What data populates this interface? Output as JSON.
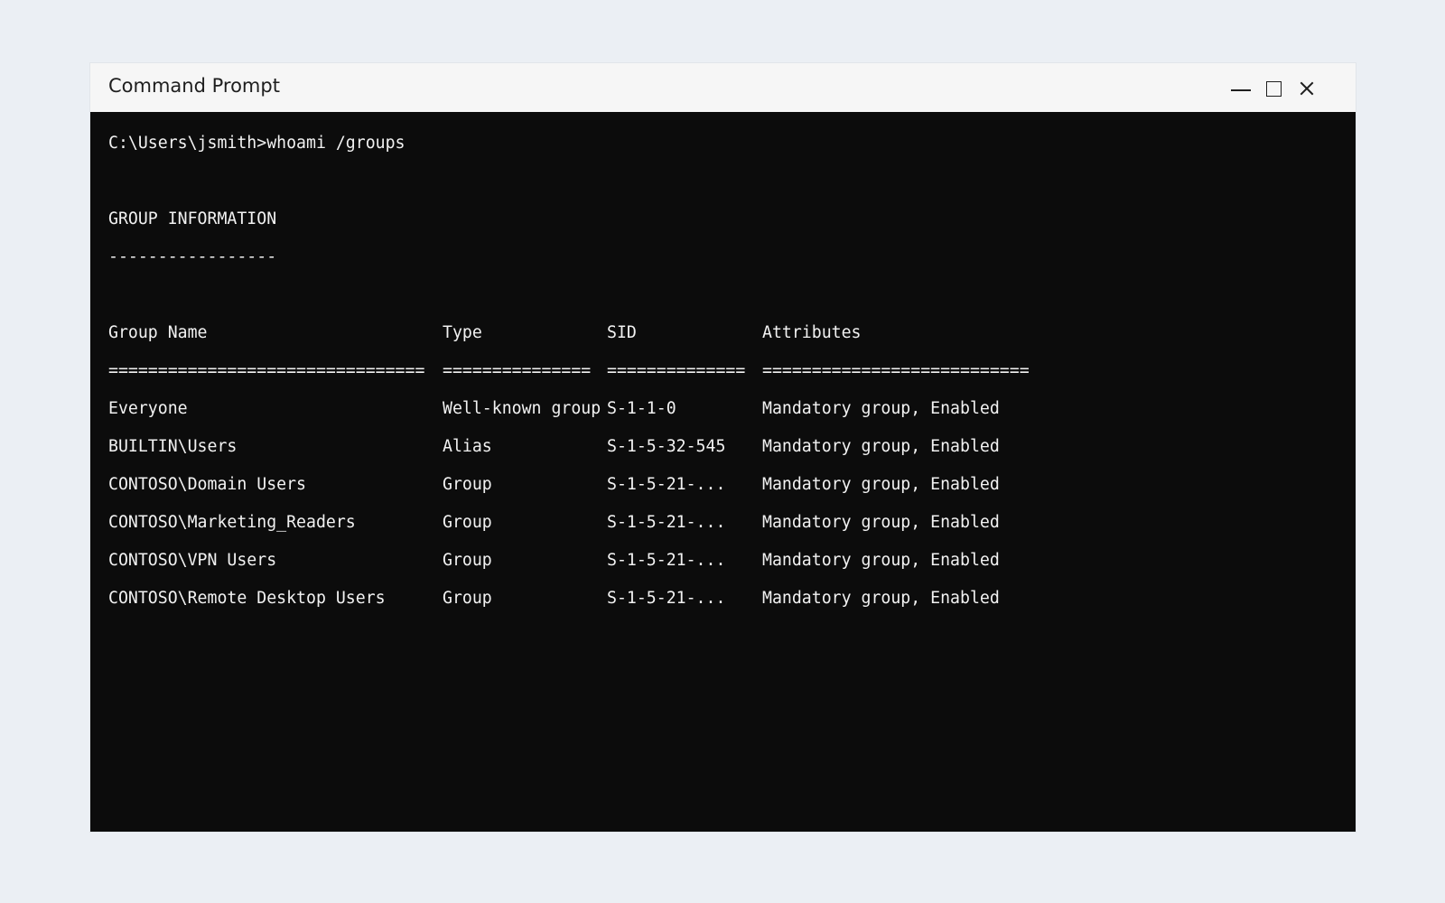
{
  "window": {
    "title": "Command Prompt",
    "controls": {
      "minimize_icon": "minimize-icon",
      "maximize_icon": "maximize-icon",
      "close_icon": "close-icon"
    }
  },
  "terminal": {
    "prompt": "C:\\Users\\jsmith>whoami /groups",
    "section_title": "GROUP INFORMATION",
    "section_rule": "-----------------",
    "headers": {
      "group_name": "Group Name",
      "type": "Type",
      "sid": "SID",
      "attributes": "Attributes"
    },
    "separators": {
      "group_name": "================================",
      "type": "===============",
      "sid": "==============",
      "attributes": "==========================="
    },
    "rows": [
      {
        "group_name": "Everyone",
        "type": "Well-known group",
        "sid": "S-1-1-0",
        "attributes": "Mandatory group, Enabled"
      },
      {
        "group_name": "BUILTIN\\Users",
        "type": "Alias",
        "sid": "S-1-5-32-545",
        "attributes": "Mandatory group, Enabled"
      },
      {
        "group_name": "CONTOSO\\Domain Users",
        "type": "Group",
        "sid": "S-1-5-21-...",
        "attributes": "Mandatory group, Enabled"
      },
      {
        "group_name": "CONTOSO\\Marketing_Readers",
        "type": "Group",
        "sid": "S-1-5-21-...",
        "attributes": "Mandatory group, Enabled"
      },
      {
        "group_name": "CONTOSO\\VPN Users",
        "type": "Group",
        "sid": "S-1-5-21-...",
        "attributes": "Mandatory group, Enabled"
      },
      {
        "group_name": "CONTOSO\\Remote Desktop Users",
        "type": "Group",
        "sid": "S-1-5-21-...",
        "attributes": "Mandatory group, Enabled"
      }
    ]
  },
  "colors": {
    "desktop_bg": "#ebeff4",
    "titlebar_bg": "#f6f6f6",
    "terminal_bg": "#0c0c0c",
    "terminal_text": "#f2f2f2"
  }
}
